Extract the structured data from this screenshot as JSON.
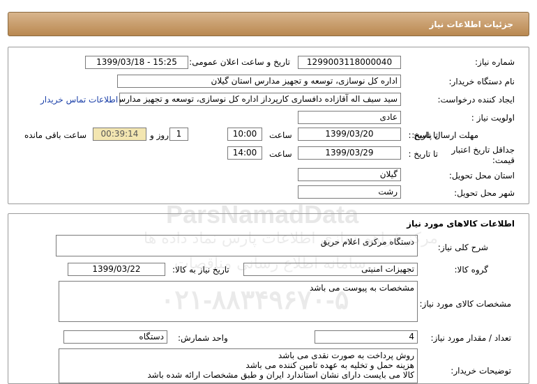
{
  "header": {
    "title": "جزئیات اطلاعات نیاز"
  },
  "labels": {
    "need_number": "شماره نیاز:",
    "announce_datetime": "تاریخ و ساعت اعلان عمومی:",
    "buyer_org": "نام دستگاه خریدار:",
    "requester": "ایجاد کننده درخواست:",
    "priority": "اولویت نیاز :",
    "send_deadline": "مهلت ارسال پاسخ:",
    "to_date_1": "تا تاریخ :",
    "time_1": "ساعت",
    "days": "روز و",
    "remaining": "ساعت باقی مانده",
    "price_validity": "جداقل تاریخ اعتبار قیمت:",
    "to_date_2": "تا تاریخ :",
    "time_2": "ساعت",
    "province": "استان محل تحویل:",
    "city": "شهر محل تحویل:"
  },
  "values": {
    "need_number": "1299003118000040",
    "announce_datetime": "1399/03/18 - 15:25",
    "buyer_org": "اداره کل نوسازی، توسعه و تجهیز مدارس استان گیلان",
    "requester": "سید سیف اله آقازاده دافساری کارپرداز اداره کل نوسازی، توسعه و تجهیز مدارس",
    "contact_link": "اطلاعات تماس خریدار",
    "priority": "عادی",
    "send_date": "1399/03/20",
    "send_time": "10:00",
    "days_count": "1",
    "remaining_time": "00:39:14",
    "validity_date": "1399/03/29",
    "validity_time": "14:00",
    "province": "گیلان",
    "city": "رشت"
  },
  "goods": {
    "title": "اطلاعات کالاهای مورد نیاز",
    "labels": {
      "general_desc": "شرح کلی نیاز:",
      "goods_group": "گروه کالا:",
      "need_date": "تاریخ نیاز به کالا:",
      "specs": "مشخصات کالای مورد نیاز:",
      "quantity": "تعداد / مقدار مورد نیاز:",
      "unit": "واحد شمارش:",
      "buyer_notes": "توضیحات خریدار:"
    },
    "values": {
      "general_desc": "دستگاه مرکزی اعلام حریق",
      "goods_group": "تجهیزات امنیتی",
      "need_date": "1399/03/22",
      "specs": "مشخصات به پیوست می باشد",
      "quantity": "4",
      "unit": "دستگاه",
      "notes_line1": "روش پرداخت به صورت نقدی می باشد",
      "notes_line2": "هزینه حمل و تخلیه به عهده تامین کننده می باشد",
      "notes_line3": "کالا می بایست دارای نشان استاندارد ایران و طبق مشخصات ارائه شده باشد"
    }
  },
  "watermark": {
    "brand": "ParsNamadData",
    "line_fa": "مرکز فراهم سازی اطلاعات پارس نماد داده ها",
    "line_fa2": "سامانه اطلاع رسانی مناقصات",
    "phone": "۰۲۱-۸۸۳۴۹۶۷۰-۵"
  }
}
